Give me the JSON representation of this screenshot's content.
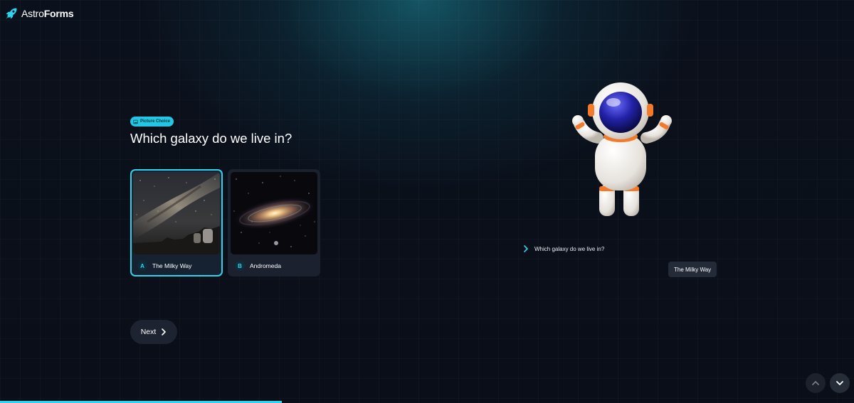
{
  "brand": {
    "name_part1": "Astro",
    "name_part2": "Forms"
  },
  "question": {
    "type_badge": "Picture Choice",
    "title": "Which galaxy do we live in?"
  },
  "choices": [
    {
      "key": "A",
      "label": "The Milky Way",
      "selected": true
    },
    {
      "key": "B",
      "label": "Andromeda",
      "selected": false
    }
  ],
  "next_button": {
    "label": "Next"
  },
  "summary": {
    "question": "Which galaxy do we live in?",
    "answer": "The Milky Way"
  },
  "progress": {
    "fraction": 0.33
  },
  "colors": {
    "accent": "#2bd4ef",
    "background": "#0b0f1a",
    "card": "#1c2130"
  },
  "icons": [
    "rocket-icon",
    "image-icon",
    "chevron-right-icon",
    "chevron-up-icon",
    "chevron-down-icon"
  ]
}
